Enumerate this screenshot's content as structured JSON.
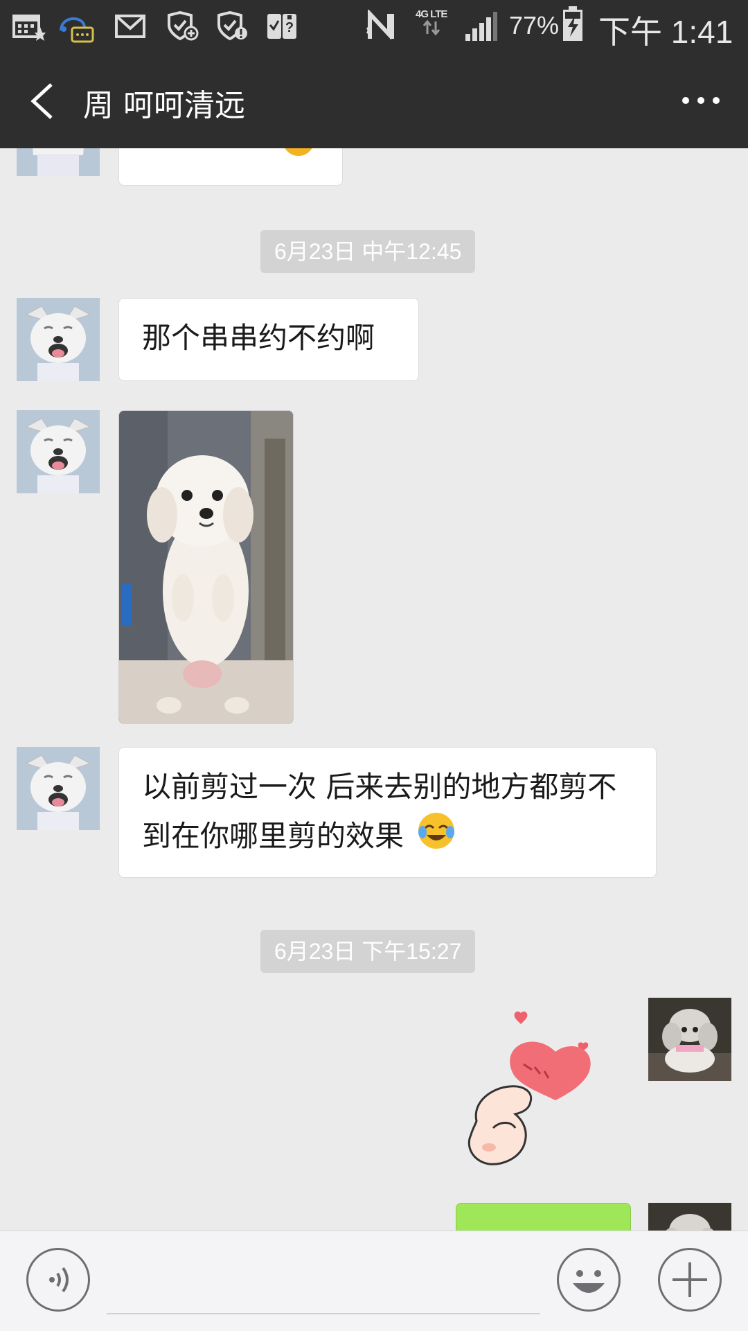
{
  "status_bar": {
    "network_label": "4G LTE",
    "battery": "77%",
    "time": "下午 1:41",
    "icons": [
      "calendar-star-icon",
      "chat-bot-icon",
      "mail-icon",
      "shield-plus-icon",
      "shield-alert-icon",
      "sim-toolkit-icon",
      "nfc-icon",
      "data-arrows-icon",
      "signal-icon",
      "battery-charging-icon"
    ]
  },
  "nav": {
    "title": "周 呵呵清远"
  },
  "messages": {
    "ts1": "6月23日 中午12:45",
    "msg1": "那个串串约不约啊",
    "msg3": "以前剪过一次 后来去别的地方都剪不到在你哪里剪的效果",
    "ts2": "6月23日 下午15:27"
  },
  "colors": {
    "header": "#2e2e2e",
    "chat_bg": "#ebebeb",
    "bubble_sent": "#9fe658",
    "bubble_received": "#ffffff"
  }
}
